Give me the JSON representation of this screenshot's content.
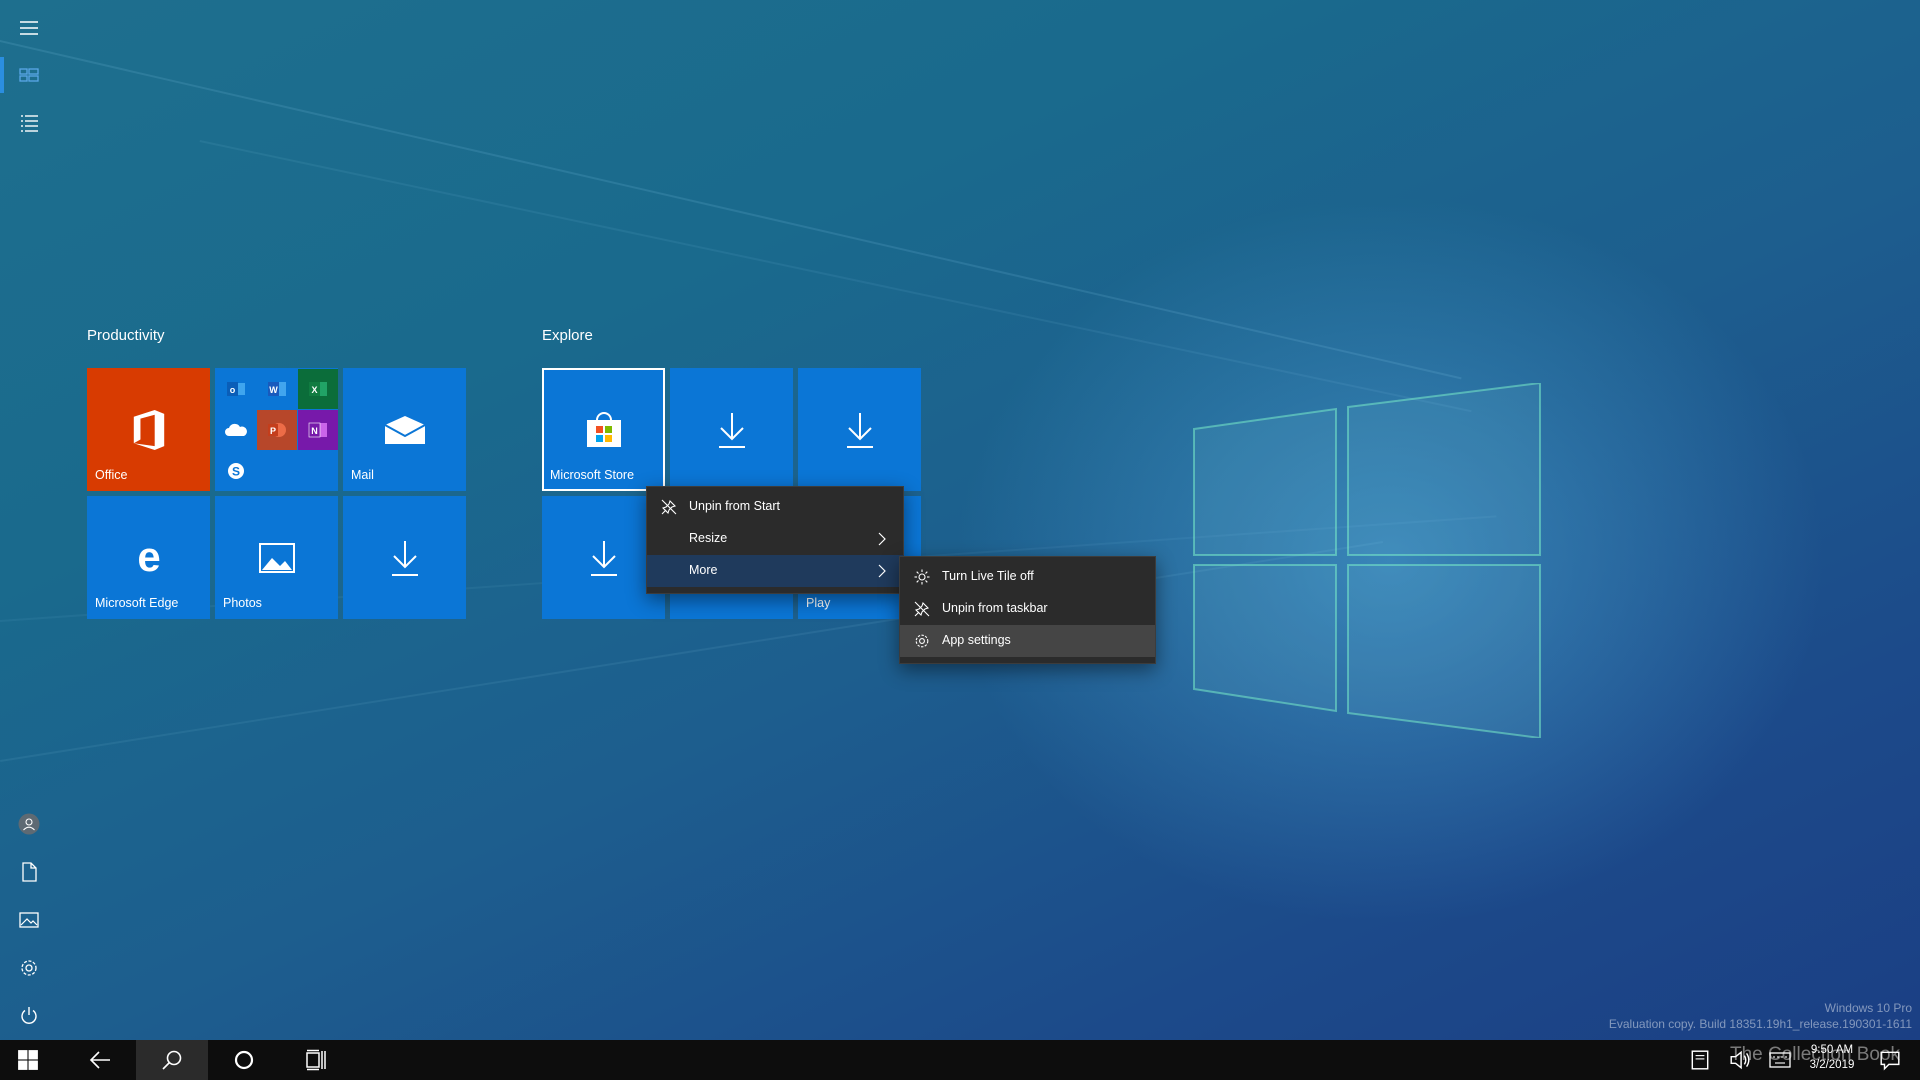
{
  "groups": [
    {
      "title": "Productivity"
    },
    {
      "title": "Explore"
    }
  ],
  "tiles": {
    "office": {
      "label": "Office"
    },
    "mail": {
      "label": "Mail"
    },
    "edge": {
      "label": "Microsoft Edge"
    },
    "photos": {
      "label": "Photos"
    },
    "store": {
      "label": "Microsoft Store"
    },
    "play": {
      "label": "Play"
    }
  },
  "context_menu": {
    "items": [
      {
        "label": "Unpin from Start",
        "icon": "unpin-icon"
      },
      {
        "label": "Resize",
        "icon": "chevron-right-icon"
      },
      {
        "label": "More",
        "icon": "chevron-right-icon"
      }
    ]
  },
  "submenu": {
    "items": [
      {
        "label": "Turn Live Tile off",
        "icon": "live-tile-icon"
      },
      {
        "label": "Unpin from taskbar",
        "icon": "unpin-icon"
      },
      {
        "label": "App settings",
        "icon": "gear-icon"
      }
    ]
  },
  "system": {
    "watermark_line1": "Windows 10 Pro",
    "watermark_line2": "Evaluation copy. Build 18351.19h1_release.190301-1611",
    "time": "9:50 AM",
    "date": "3/2/2019",
    "brand_watermark": "The Collection Book"
  },
  "colors": {
    "tile_blue": "#0b76d6",
    "office_orange": "#d83b01",
    "menu_bg": "#2b2b2b",
    "highlight": "#1f3a5c"
  }
}
